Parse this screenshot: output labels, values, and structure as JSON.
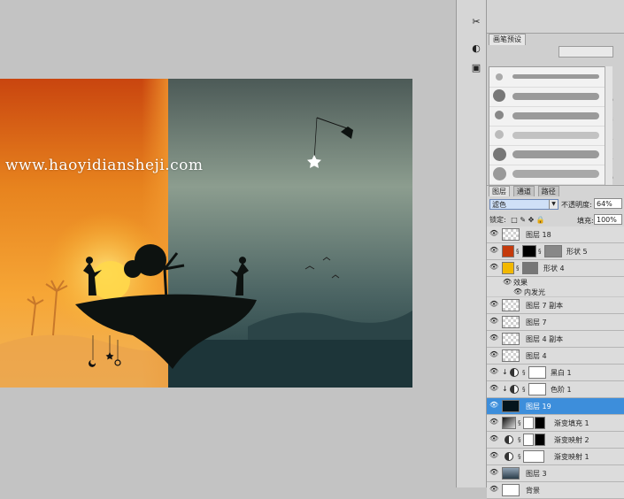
{
  "canvas": {
    "watermark": "www.haoyidiansheji.com"
  },
  "tools": [
    "scissors-icon",
    "brush-icon",
    "stamp-icon"
  ],
  "brush_panel": {
    "tab_label": "画笔预设",
    "brush_sizes": [
      "",
      "70",
      "33",
      "45",
      "55",
      "70",
      ""
    ]
  },
  "layers_panel": {
    "tabs": [
      "图层",
      "通道",
      "路径"
    ],
    "blend_mode": "滤色",
    "opacity_label": "不透明度:",
    "opacity_value": "64%",
    "lock_label": "锁定:",
    "fill_label": "填充:",
    "fill_value": "100%",
    "effects_label": "效果",
    "inner_glow_label": "内发光",
    "layers": [
      {
        "name": "图层 18"
      },
      {
        "name": "形状 5"
      },
      {
        "name": "形状 4"
      },
      {
        "name": "图层 7 副本"
      },
      {
        "name": "图层 7"
      },
      {
        "name": "图层 4 副本"
      },
      {
        "name": "图层 4"
      },
      {
        "name": "黑白 1"
      },
      {
        "name": "色阶 1"
      },
      {
        "name": "图层 19"
      },
      {
        "name": "渐变填充 1"
      },
      {
        "name": "渐变映射 2"
      },
      {
        "name": "渐变映射 1"
      },
      {
        "name": "图层 3"
      },
      {
        "name": "背景"
      }
    ]
  },
  "colors": {
    "accent_selected": "#3d8edb",
    "shape4_color": "#f2b800",
    "shape5_color": "#c43a0c"
  }
}
